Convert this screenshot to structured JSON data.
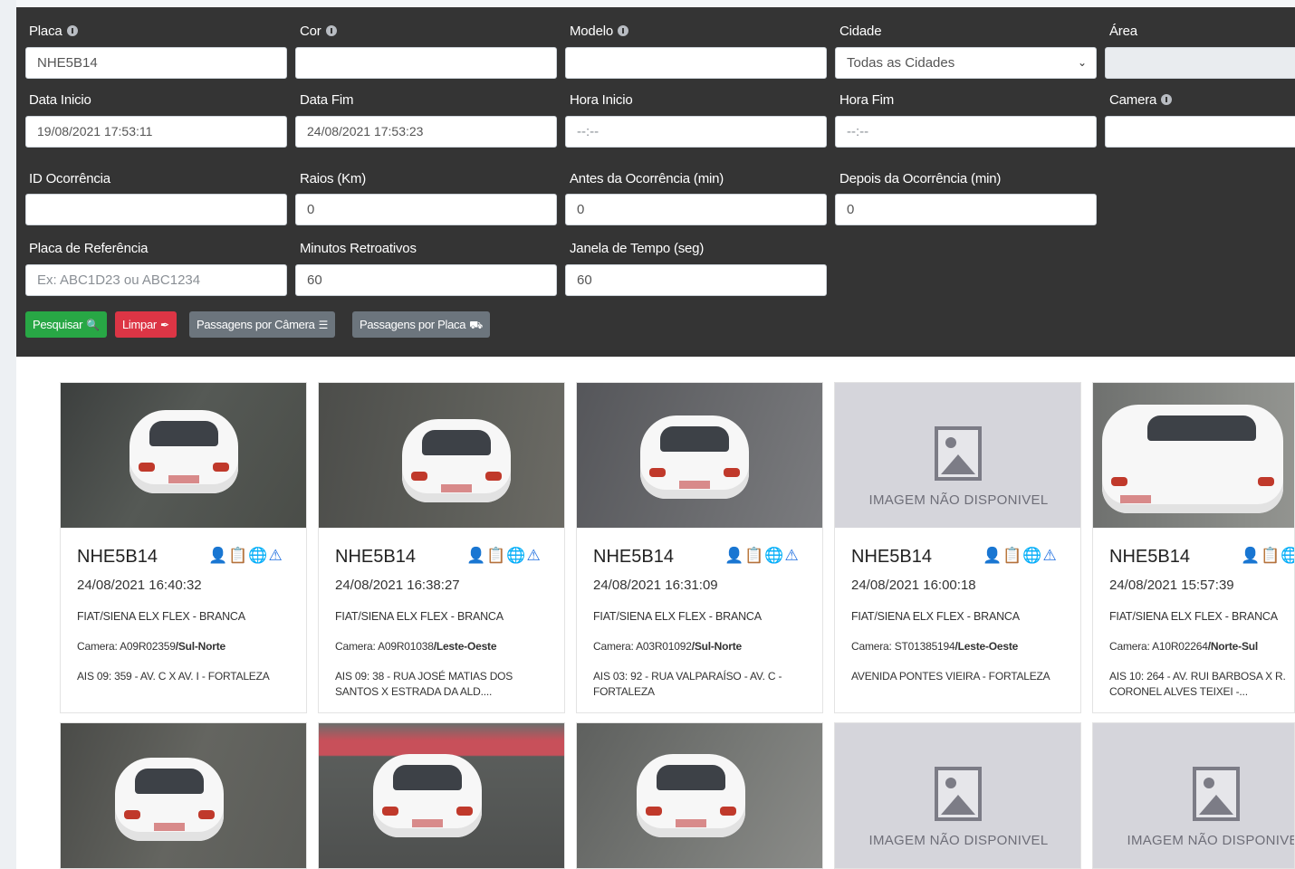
{
  "filters": {
    "placa": {
      "label": "Placa",
      "value": "NHE5B14"
    },
    "cor": {
      "label": "Cor",
      "value": ""
    },
    "modelo": {
      "label": "Modelo",
      "value": ""
    },
    "cidade": {
      "label": "Cidade",
      "value": "Todas as Cidades"
    },
    "area": {
      "label": "Área",
      "value": ""
    },
    "data_inicio": {
      "label": "Data Inicio",
      "value": "19/08/2021 17:53:11"
    },
    "data_fim": {
      "label": "Data Fim",
      "value": "24/08/2021 17:53:23"
    },
    "hora_inicio": {
      "label": "Hora Inicio",
      "placeholder": "--:--"
    },
    "hora_fim": {
      "label": "Hora Fim",
      "placeholder": "--:--"
    },
    "camera": {
      "label": "Camera",
      "value": ""
    },
    "id_ocorrencia": {
      "label": "ID Ocorrência",
      "value": ""
    },
    "raios": {
      "label": "Raios (Km)",
      "value": "0"
    },
    "antes": {
      "label": "Antes da Ocorrência (min)",
      "value": "0"
    },
    "depois": {
      "label": "Depois da Ocorrência (min)",
      "value": "0"
    },
    "placa_ref": {
      "label": "Placa de Referência",
      "placeholder": "Ex: ABC1D23 ou ABC1234"
    },
    "minutos": {
      "label": "Minutos Retroativos",
      "value": "60"
    },
    "janela": {
      "label": "Janela de Tempo (seg)",
      "value": "60"
    }
  },
  "buttons": {
    "pesquisar": "Pesquisar",
    "limpar": "Limpar",
    "passagens_camera": "Passagens por Câmera",
    "passagens_placa": "Passagens por Placa"
  },
  "colors": {
    "pesquisar": "#28a745",
    "limpar": "#dc3545",
    "secondary": "#6c757d",
    "icons": "#1f6fe0"
  },
  "no_image_text": "IMAGEM NÃO DISPONIVEL",
  "results": [
    {
      "plate": "NHE5B14",
      "date": "24/08/2021 16:40:32",
      "model": "FIAT/SIENA ELX FLEX - BRANCA",
      "camera_prefix": "Camera: ",
      "camera_id": "A09R02359",
      "camera_dir": "/Sul-Norte",
      "address": "AIS 09: 359 - AV. C X AV. I - FORTALEZA",
      "has_image": true
    },
    {
      "plate": "NHE5B14",
      "date": "24/08/2021 16:38:27",
      "model": "FIAT/SIENA ELX FLEX - BRANCA",
      "camera_prefix": "Camera: ",
      "camera_id": "A09R01038",
      "camera_dir": "/Leste-Oeste",
      "address": "AIS 09: 38 - RUA JOSÉ MATIAS DOS SANTOS X ESTRADA DA ALD....",
      "has_image": true
    },
    {
      "plate": "NHE5B14",
      "date": "24/08/2021 16:31:09",
      "model": "FIAT/SIENA ELX FLEX - BRANCA",
      "camera_prefix": "Camera: ",
      "camera_id": "A03R01092",
      "camera_dir": "/Sul-Norte",
      "address": "AIS 03: 92 - RUA VALPARAÍSO - AV. C - FORTALEZA",
      "has_image": true
    },
    {
      "plate": "NHE5B14",
      "date": "24/08/2021 16:00:18",
      "model": "FIAT/SIENA ELX FLEX - BRANCA",
      "camera_prefix": "Camera: ",
      "camera_id": "ST01385194",
      "camera_dir": "/Leste-Oeste",
      "address": "AVENIDA PONTES VIEIRA - FORTALEZA",
      "has_image": false
    },
    {
      "plate": "NHE5B14",
      "date": "24/08/2021 15:57:39",
      "model": "FIAT/SIENA ELX FLEX - BRANCA",
      "camera_prefix": "Camera: ",
      "camera_id": "A10R02264",
      "camera_dir": "/Norte-Sul",
      "address": "AIS 10: 264 - AV. RUI BARBOSA X R. CORONEL ALVES TEIXEI -...",
      "has_image": true
    }
  ]
}
